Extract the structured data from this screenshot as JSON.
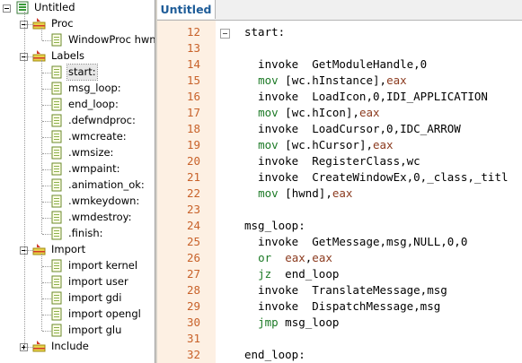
{
  "tree": {
    "root": "Untitled",
    "proc": {
      "label": "Proc",
      "items": [
        "WindowProc hwn"
      ]
    },
    "labels": {
      "label": "Labels",
      "items": [
        "start:",
        "msg_loop:",
        "end_loop:",
        ".defwndproc:",
        ".wmcreate:",
        ".wmsize:",
        ".wmpaint:",
        ".animation_ok:",
        ".wmkeydown:",
        ".wmdestroy:",
        ".finish:"
      ],
      "selected": "start:"
    },
    "import": {
      "label": "Import",
      "items": [
        "import kernel",
        "import user",
        "import gdi",
        "import opengl",
        "import glu"
      ]
    },
    "include": {
      "label": "Include"
    }
  },
  "editor": {
    "tab_label": "Untitled",
    "lines": [
      {
        "num": "12",
        "tokens": [
          {
            "t": "start:",
            "c": "n"
          }
        ]
      },
      {
        "num": "13",
        "tokens": []
      },
      {
        "num": "14",
        "tokens": [
          {
            "t": "  invoke  GetModuleHandle,0",
            "c": "n"
          }
        ]
      },
      {
        "num": "15",
        "tokens": [
          {
            "t": "  ",
            "c": "n"
          },
          {
            "t": "mov",
            "c": "kw"
          },
          {
            "t": " [wc.hInstance],",
            "c": "n"
          },
          {
            "t": "eax",
            "c": "reg"
          }
        ]
      },
      {
        "num": "16",
        "tokens": [
          {
            "t": "  invoke  LoadIcon,0,IDI_APPLICATION",
            "c": "n"
          }
        ]
      },
      {
        "num": "17",
        "tokens": [
          {
            "t": "  ",
            "c": "n"
          },
          {
            "t": "mov",
            "c": "kw"
          },
          {
            "t": " [wc.hIcon],",
            "c": "n"
          },
          {
            "t": "eax",
            "c": "reg"
          }
        ]
      },
      {
        "num": "18",
        "tokens": [
          {
            "t": "  invoke  LoadCursor,0,IDC_ARROW",
            "c": "n"
          }
        ]
      },
      {
        "num": "19",
        "tokens": [
          {
            "t": "  ",
            "c": "n"
          },
          {
            "t": "mov",
            "c": "kw"
          },
          {
            "t": " [wc.hCursor],",
            "c": "n"
          },
          {
            "t": "eax",
            "c": "reg"
          }
        ]
      },
      {
        "num": "20",
        "tokens": [
          {
            "t": "  invoke  RegisterClass,wc",
            "c": "n"
          }
        ]
      },
      {
        "num": "21",
        "tokens": [
          {
            "t": "  invoke  CreateWindowEx,0,_class,_titl",
            "c": "n"
          }
        ]
      },
      {
        "num": "22",
        "tokens": [
          {
            "t": "  ",
            "c": "n"
          },
          {
            "t": "mov",
            "c": "kw"
          },
          {
            "t": " [hwnd],",
            "c": "n"
          },
          {
            "t": "eax",
            "c": "reg"
          }
        ]
      },
      {
        "num": "23",
        "tokens": []
      },
      {
        "num": "24",
        "tokens": [
          {
            "t": "msg_loop:",
            "c": "n"
          }
        ]
      },
      {
        "num": "25",
        "tokens": [
          {
            "t": "  invoke  GetMessage,msg,NULL,0,0",
            "c": "n"
          }
        ]
      },
      {
        "num": "26",
        "tokens": [
          {
            "t": "  ",
            "c": "n"
          },
          {
            "t": "or",
            "c": "kw"
          },
          {
            "t": "  ",
            "c": "n"
          },
          {
            "t": "eax",
            "c": "reg"
          },
          {
            "t": ",",
            "c": "n"
          },
          {
            "t": "eax",
            "c": "reg"
          }
        ]
      },
      {
        "num": "27",
        "tokens": [
          {
            "t": "  ",
            "c": "n"
          },
          {
            "t": "jz",
            "c": "kw"
          },
          {
            "t": "  end_loop",
            "c": "n"
          }
        ]
      },
      {
        "num": "28",
        "tokens": [
          {
            "t": "  invoke  TranslateMessage,msg",
            "c": "n"
          }
        ]
      },
      {
        "num": "29",
        "tokens": [
          {
            "t": "  invoke  DispatchMessage,msg",
            "c": "n"
          }
        ]
      },
      {
        "num": "30",
        "tokens": [
          {
            "t": "  ",
            "c": "n"
          },
          {
            "t": "jmp",
            "c": "kw"
          },
          {
            "t": " msg_loop",
            "c": "n"
          }
        ]
      },
      {
        "num": "31",
        "tokens": []
      },
      {
        "num": "32",
        "tokens": [
          {
            "t": "end_loop:",
            "c": "n"
          }
        ]
      }
    ]
  },
  "colors": {
    "line_number": "#c8622a",
    "gutter_bg": "#fdf0e3",
    "keyword": "#1c7a26",
    "register": "#8b3a1e",
    "tab_text": "#1f5d99"
  }
}
